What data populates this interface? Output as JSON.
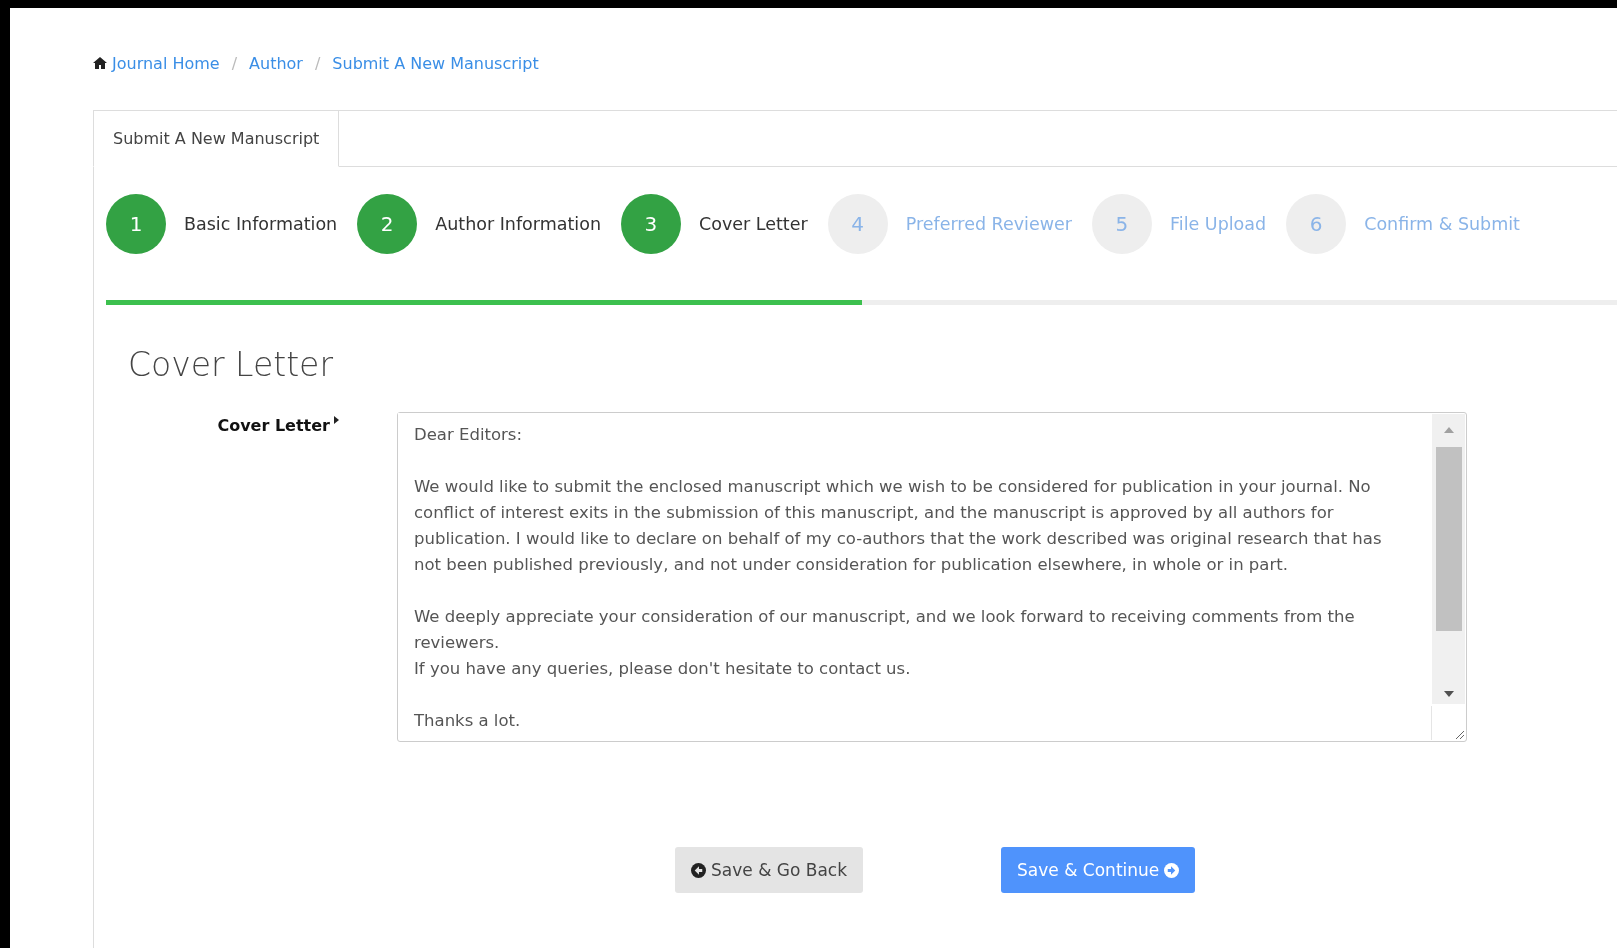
{
  "breadcrumb": {
    "separator": "/",
    "items": [
      {
        "label": "Journal Home",
        "home": true
      },
      {
        "label": "Author",
        "home": false
      },
      {
        "label": "Submit A New Manuscript",
        "home": false
      }
    ]
  },
  "tabs": [
    {
      "label": "Submit A New Manuscript",
      "selected": true
    }
  ],
  "steps": [
    {
      "number": "1",
      "label": "Basic Information",
      "done": true
    },
    {
      "number": "2",
      "label": "Author Information",
      "done": true
    },
    {
      "number": "3",
      "label": "Cover Letter",
      "done": true
    },
    {
      "number": "4",
      "label": "Preferred Reviewer",
      "done": false
    },
    {
      "number": "5",
      "label": "File Upload",
      "done": false
    },
    {
      "number": "6",
      "label": "Confirm & Submit",
      "done": false
    }
  ],
  "progress": {
    "level": 0.5
  },
  "section_title": "Cover Letter",
  "form": {
    "label": "Cover Letter",
    "required": true,
    "value": "Dear Editors:\n\nWe would like to submit the enclosed manuscript which we wish to be considered for publication in your journal. No conflict of interest exits in the submission of this manuscript, and the manuscript is approved by all authors for publication. I would like to declare on behalf of my co-authors that the work described was original research that has not been published previously, and not under consideration for publication elsewhere, in whole or in part.\n\nWe deeply appreciate your consideration of our manuscript, and we look forward to receiving comments from the reviewers.\nIf you have any queries, please don't hesitate to contact us.\n\nThanks a lot."
  },
  "buttons": [
    {
      "label": "Save & Go Back",
      "kind": "back"
    },
    {
      "label": "Save & Continue",
      "kind": "continue"
    }
  ]
}
